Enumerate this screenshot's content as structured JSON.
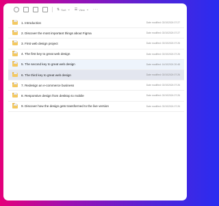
{
  "toolbar": {
    "sort_label": "Sort",
    "view_label": "View",
    "more_label": "···"
  },
  "files": [
    {
      "name": "1. Introduction",
      "date": "Date modified: 02/10/2024 07:27"
    },
    {
      "name": "2. Discover the most important things about Figma",
      "date": "Date modified: 02/10/2024 07:27"
    },
    {
      "name": "3. First web design project",
      "date": "Date modified: 02/10/2024 07:26"
    },
    {
      "name": "4. The first key to great web design",
      "date": "Date modified: 02/10/2024 07:26"
    },
    {
      "name": "5. The second key to great web design",
      "date": "Date modified: 14/10/2024 20:48"
    },
    {
      "name": "6. The third key to great web design",
      "date": "Date modified: 02/10/2024 07:26"
    },
    {
      "name": "7. Redesign an e-commerce business",
      "date": "Date modified: 02/10/2024 07:26"
    },
    {
      "name": "8. Responsive design from desktop to mobile",
      "date": "Date modified: 02/10/2024 07:26"
    },
    {
      "name": "9. Discover how the design gets transformed to the live version",
      "date": "Date modified: 02/10/2024 07:26"
    }
  ]
}
